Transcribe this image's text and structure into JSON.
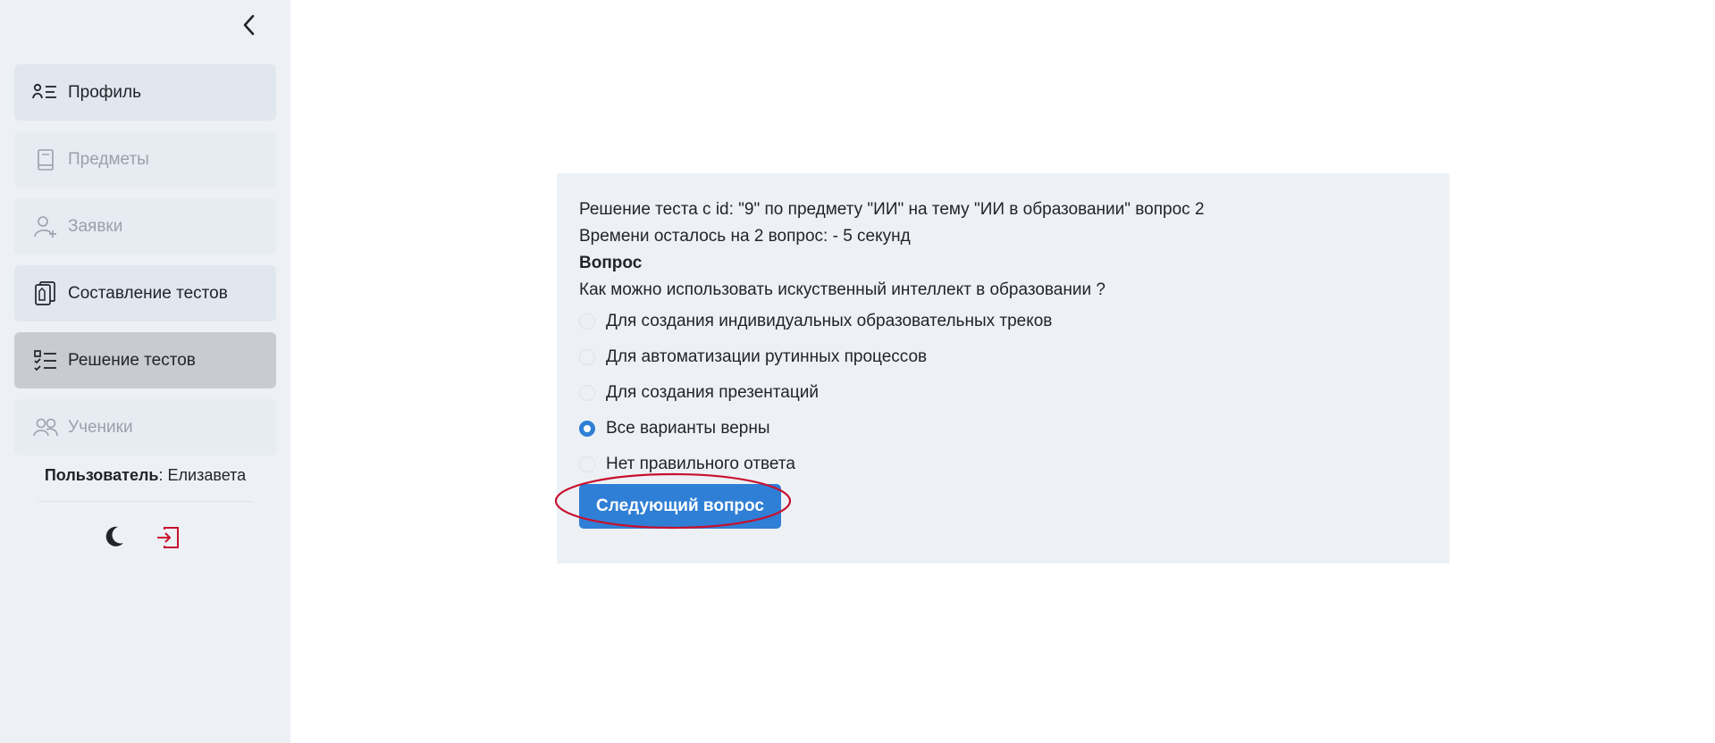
{
  "sidebar": {
    "items": [
      {
        "label": "Профиль",
        "icon": "profile-list-icon",
        "state": "normal"
      },
      {
        "label": "Предметы",
        "icon": "book-icon",
        "state": "disabled"
      },
      {
        "label": "Заявки",
        "icon": "user-plus-icon",
        "state": "disabled"
      },
      {
        "label": "Составление тестов",
        "icon": "files-pen-icon",
        "state": "normal"
      },
      {
        "label": "Решение тестов",
        "icon": "checklist-icon",
        "state": "active"
      },
      {
        "label": "Ученики",
        "icon": "people-icon",
        "state": "disabled"
      }
    ],
    "user_label": "Пользователь",
    "user_sep": ": ",
    "user_name": "Елизавета"
  },
  "test": {
    "title": "Решение теста с id: \"9\" по предмету \"ИИ\" на тему \"ИИ в образовании\" вопрос 2",
    "timer": "Времени осталось на 2 вопрос: - 5 секунд",
    "question_heading": "Вопрос",
    "question_text": "Как можно использовать искуственный интеллект в образовании ?",
    "options": [
      {
        "label": "Для создания индивидуальных образовательных треков",
        "checked": false
      },
      {
        "label": "Для автоматизации рутинных процессов",
        "checked": false
      },
      {
        "label": "Для создания презентаций",
        "checked": false
      },
      {
        "label": "Все варианты верны",
        "checked": true
      },
      {
        "label": "Нет правильного ответа",
        "checked": false
      }
    ],
    "next_button": "Следующий вопрос"
  },
  "colors": {
    "accent": "#2f7fd6",
    "sidebar_bg": "#edf1f5",
    "annotation": "#c8102e",
    "logout": "#c8102e"
  }
}
